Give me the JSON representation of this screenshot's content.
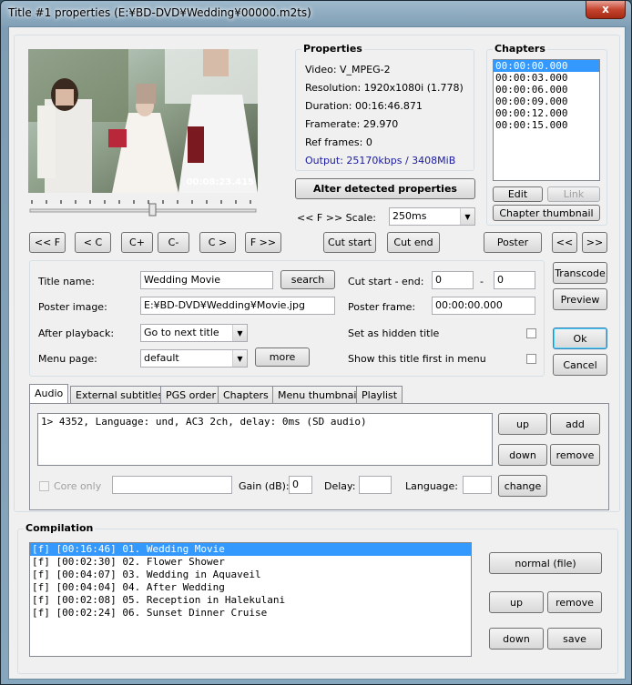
{
  "window": {
    "title": "Title #1 properties (E:¥BD-DVD¥Wedding¥00000.m2ts)",
    "close": "x"
  },
  "preview": {
    "timestamp": "00:08:23.415"
  },
  "properties": {
    "title": "Properties",
    "video": "Video: V_MPEG-2",
    "resolution": "Resolution: 1920x1080i (1.778)",
    "duration": "Duration: 00:16:46.871",
    "framerate": "Framerate: 29.970",
    "ref_frames": "Ref frames: 0",
    "output": "Output: 25170kbps / 3408MiB",
    "alter_label": "Alter detected properties",
    "scale_label": "<< F >> Scale:",
    "scale_value": "250ms"
  },
  "chapters": {
    "title": "Chapters",
    "items": [
      "00:00:00.000",
      "00:00:03.000",
      "00:00:06.000",
      "00:00:09.000",
      "00:00:12.000",
      "00:00:15.000"
    ],
    "edit": "Edit",
    "link": "Link",
    "thumbnail": "Chapter thumbnail"
  },
  "nav": {
    "ff_back": "<< F",
    "c_back": "< C",
    "c_plus": "C+",
    "c_minus": "C-",
    "c_fwd": "C >",
    "ff_fwd": "F >>",
    "cut_start": "Cut start",
    "cut_end": "Cut end",
    "poster": "Poster",
    "prev": "<<",
    "next": ">>"
  },
  "form": {
    "title_name_label": "Title name:",
    "title_name_value": "Wedding Movie",
    "search": "search",
    "poster_image_label": "Poster image:",
    "poster_image_value": "E:¥BD-DVD¥Wedding¥Movie.jpg",
    "after_playback_label": "After playback:",
    "after_playback_value": "Go to next title",
    "menu_page_label": "Menu page:",
    "menu_page_value": "default",
    "more": "more",
    "cut_label": "Cut start - end:",
    "cut_start_value": "0",
    "cut_dash": "-",
    "cut_end_value": "0",
    "poster_frame_label": "Poster frame:",
    "poster_frame_value": "00:00:00.000",
    "hidden_label": "Set as hidden title",
    "show_first_label": "Show this title first in menu"
  },
  "side": {
    "transcode": "Transcode",
    "preview": "Preview",
    "ok": "Ok",
    "cancel": "Cancel"
  },
  "tabs": [
    "Audio",
    "External subtitles",
    "PGS order",
    "Chapters",
    "Menu thumbnails",
    "Playlist"
  ],
  "audio": {
    "items": [
      "1> 4352, Language: und, AC3 2ch, delay: 0ms (SD audio)"
    ],
    "up": "up",
    "add": "add",
    "down": "down",
    "remove": "remove",
    "core_only": "Core only",
    "gain_label": "Gain (dB):",
    "gain_value": "0",
    "delay_label": "Delay:",
    "language_label": "Language:",
    "change": "change"
  },
  "compilation": {
    "title": "Compilation",
    "items": [
      "[f] [00:16:46] 01. Wedding Movie",
      "[f] [00:02:30] 02. Flower Shower",
      "[f] [00:04:07] 03. Wedding in Aquaveil",
      "[f] [00:04:04] 04. After Wedding",
      "[f] [00:02:08] 05. Reception in Halekulani",
      "[f] [00:02:24] 06. Sunset Dinner Cruise"
    ],
    "normal": "normal (file)",
    "up": "up",
    "remove": "remove",
    "down": "down",
    "save": "save"
  }
}
